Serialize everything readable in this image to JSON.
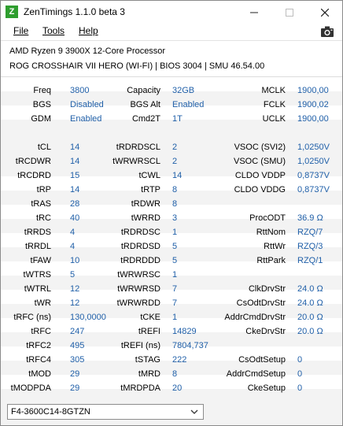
{
  "window": {
    "title": "ZenTimings 1.1.0 beta 3",
    "icon_letter": "Z"
  },
  "menu": {
    "file": "File",
    "tools": "Tools",
    "help": "Help"
  },
  "info": {
    "cpu": "AMD Ryzen 9 3900X 12-Core Processor",
    "board": "ROG CROSSHAIR VII HERO (WI-FI) | BIOS 3004 | SMU 46.54.00"
  },
  "top": [
    [
      "Freq",
      "3800",
      "Capacity",
      "32GB",
      "MCLK",
      "1900,00"
    ],
    [
      "BGS",
      "Disabled",
      "BGS Alt",
      "Enabled",
      "FCLK",
      "1900,02"
    ],
    [
      "GDM",
      "Enabled",
      "Cmd2T",
      "1T",
      "UCLK",
      "1900,00"
    ]
  ],
  "timings": [
    [
      "tCL",
      "14",
      "tRDRDSCL",
      "2",
      "VSOC (SVI2)",
      "1,0250V"
    ],
    [
      "tRCDWR",
      "14",
      "tWRWRSCL",
      "2",
      "VSOC (SMU)",
      "1,0250V"
    ],
    [
      "tRCDRD",
      "15",
      "tCWL",
      "14",
      "CLDO VDDP",
      "0,8737V"
    ],
    [
      "tRP",
      "14",
      "tRTP",
      "8",
      "CLDO VDDG",
      "0,8737V"
    ],
    [
      "tRAS",
      "28",
      "tRDWR",
      "8",
      "",
      ""
    ],
    [
      "tRC",
      "40",
      "tWRRD",
      "3",
      "ProcODT",
      "36.9 Ω"
    ],
    [
      "tRRDS",
      "4",
      "tRDRDSC",
      "1",
      "RttNom",
      "RZQ/7"
    ],
    [
      "tRRDL",
      "4",
      "tRDRDSD",
      "5",
      "RttWr",
      "RZQ/3"
    ],
    [
      "tFAW",
      "10",
      "tRDRDDD",
      "5",
      "RttPark",
      "RZQ/1"
    ],
    [
      "tWTRS",
      "5",
      "tWRWRSC",
      "1",
      "",
      ""
    ],
    [
      "tWTRL",
      "12",
      "tWRWRSD",
      "7",
      "ClkDrvStr",
      "24.0 Ω"
    ],
    [
      "tWR",
      "12",
      "tWRWRDD",
      "7",
      "CsOdtDrvStr",
      "24.0 Ω"
    ],
    [
      "tRFC (ns)",
      "130,0000",
      "tCKE",
      "1",
      "AddrCmdDrvStr",
      "20.0 Ω"
    ],
    [
      "tRFC",
      "247",
      "tREFI",
      "14829",
      "CkeDrvStr",
      "20.0 Ω"
    ],
    [
      "tRFC2",
      "495",
      "tREFI (ns)",
      "7804,737",
      "",
      ""
    ],
    [
      "tRFC4",
      "305",
      "tSTAG",
      "222",
      "CsOdtSetup",
      "0"
    ],
    [
      "tMOD",
      "29",
      "tMRD",
      "8",
      "AddrCmdSetup",
      "0"
    ],
    [
      "tMODPDA",
      "29",
      "tMRDPDA",
      "20",
      "CkeSetup",
      "0"
    ]
  ],
  "profile": {
    "selected": "F4-3600C14-8GTZN"
  },
  "colors": {
    "value": "#1f5fa8",
    "label": "#000000",
    "background": "#f3f3f3",
    "band": "#ffffff"
  }
}
